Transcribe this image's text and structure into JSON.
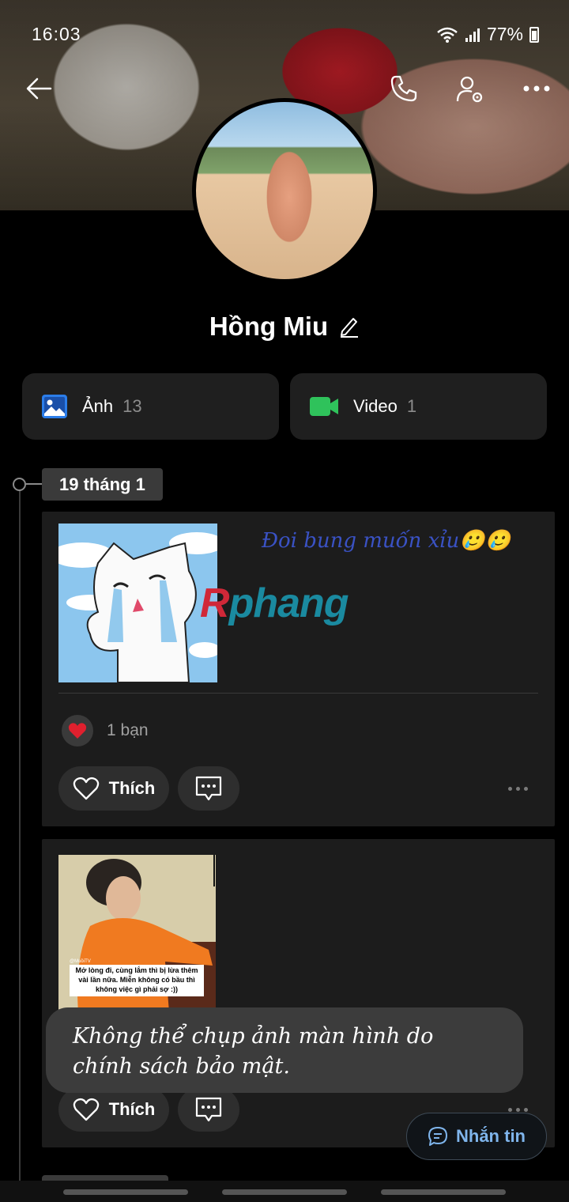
{
  "status_bar": {
    "time": "16:03",
    "battery": "77%"
  },
  "profile": {
    "name": "Hồng Miu"
  },
  "media": {
    "photos": {
      "label": "Ảnh",
      "count": "13"
    },
    "videos": {
      "label": "Video",
      "count": "1"
    }
  },
  "timeline": {
    "date": "19 tháng 1"
  },
  "posts": [
    {
      "caption": "Đoi bung muốn xỉu🥲🥲",
      "watermark_r": "R",
      "watermark_rest": "phang",
      "reactions": "1 bạn",
      "like_label": "Thích"
    },
    {
      "image_text_1": "@MuồiTV",
      "image_text_2": "Mở lòng đi, cùng lắm thì bị lừa thêm vài lần nữa. Miễn không có bầu thì không việc gì phải sợ :))",
      "like_label": "Thích"
    }
  ],
  "toast": {
    "text": "Không thể chụp ảnh màn hình do chính sách bảo mật."
  },
  "message_button": {
    "label": "Nhắn tin"
  },
  "colors": {
    "accent_blue": "#7fb5ec",
    "heart_red": "#e0202e",
    "photo_icon": "#2b7de9",
    "video_icon": "#2fc25b"
  }
}
